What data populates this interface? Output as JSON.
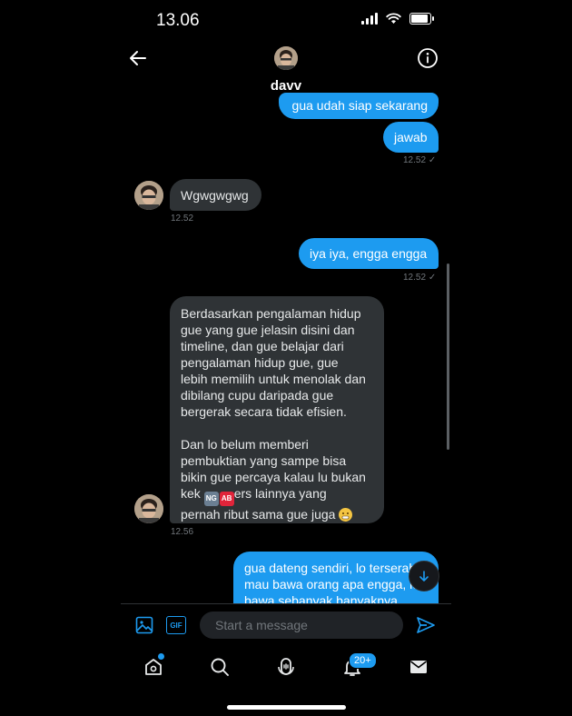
{
  "status_bar": {
    "time": "13.06"
  },
  "header": {
    "name": "davv"
  },
  "messages": [
    {
      "id": "m1",
      "text": "gua udah siap sekarang",
      "direction": "out"
    },
    {
      "id": "m2",
      "text": "jawab",
      "direction": "out",
      "time": "12.52"
    },
    {
      "id": "m3",
      "text": "Wgwgwgwg",
      "direction": "in",
      "time": "12.52"
    },
    {
      "id": "m4",
      "text": "iya iya, engga engga",
      "direction": "out",
      "time": "12.52"
    },
    {
      "id": "m5",
      "direction": "in",
      "time": "12.56",
      "para1_lines": [
        "Berdasarkan pengalaman hidup",
        "gue yang gue jelasin disini dan",
        "timeline, dan gue belajar dari",
        "pengalaman hidup gue, gue",
        "lebih memilih untuk menolak dan",
        "dibilang cupu daripada gue",
        "bergerak secara tidak efisien."
      ],
      "para2_lines": [
        "Dan lo belum memberi",
        "pembuktian yang sampe bisa",
        "bikin gue percaya kalau lu bukan"
      ],
      "line_kek_prefix": "kek",
      "emoji_ng": "NG",
      "emoji_ab": "AB",
      "line_kek_suffix": "ers lainnya yang",
      "last_line": "pernah ribut sama gue juga"
    },
    {
      "id": "m6",
      "direction": "out",
      "lines": [
        "gua dateng sendiri, lo terserah",
        "mau bawa orang apa engga, lo",
        "bawa sebanyak banyaknya"
      ]
    }
  ],
  "composer": {
    "placeholder": "Start a message"
  },
  "icons": {
    "back": "arrow-left-icon",
    "info": "info-icon",
    "media": "image-icon",
    "gif": "GIF",
    "send": "send-icon",
    "home": "home-icon",
    "search": "search-icon",
    "spaces": "spaces-icon",
    "notifications": "bell-icon",
    "messages": "mail-icon",
    "scroll": "arrow-down-icon"
  },
  "tabbar": {
    "notification_count": "20+"
  },
  "colors": {
    "accent": "#1d9bf0",
    "bubble_in": "#2f3336",
    "background": "#000000"
  }
}
